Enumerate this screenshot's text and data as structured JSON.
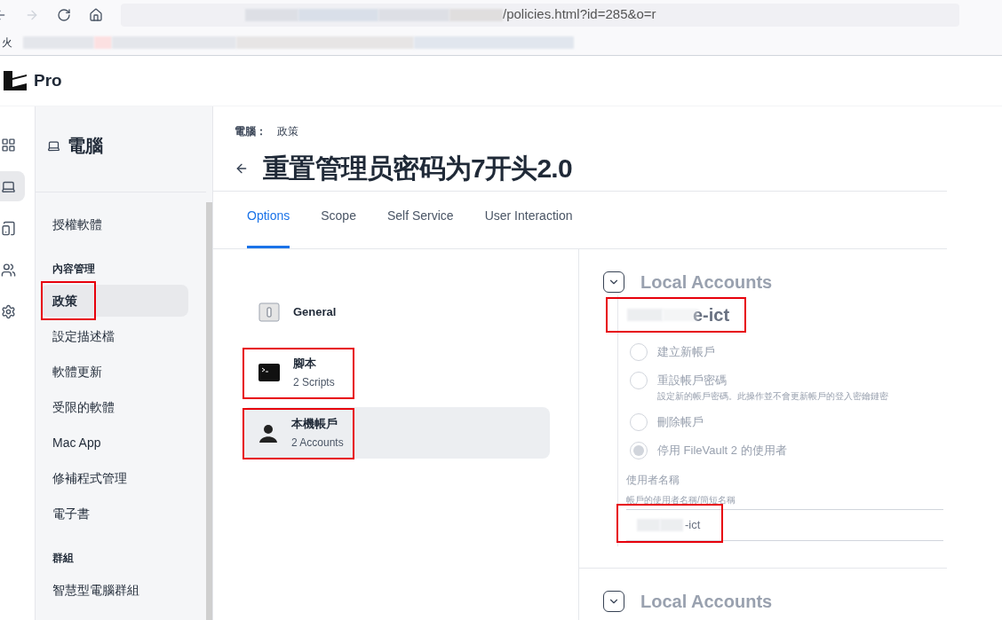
{
  "browser": {
    "url_fragment": "/policies.html?id=285&o=r",
    "bookmark_fragment": "火"
  },
  "app": {
    "product": "Pro"
  },
  "rail": [
    {
      "kind": "grid",
      "selected": false
    },
    {
      "kind": "laptop",
      "selected": true
    },
    {
      "kind": "devices",
      "selected": false
    },
    {
      "kind": "users",
      "selected": false
    },
    {
      "kind": "settings",
      "selected": false
    }
  ],
  "sidebar": {
    "title": "電腦",
    "sections": [
      {
        "items": [
          {
            "label": "授權軟體",
            "selected": false,
            "annotated": false
          }
        ]
      },
      {
        "heading": "內容管理",
        "items": [
          {
            "label": "政策",
            "selected": true,
            "annotated": true
          },
          {
            "label": "設定描述檔",
            "selected": false,
            "annotated": false
          },
          {
            "label": "軟體更新",
            "selected": false,
            "annotated": false
          },
          {
            "label": "受限的軟體",
            "selected": false,
            "annotated": false
          },
          {
            "label": "Mac App",
            "selected": false,
            "annotated": false
          },
          {
            "label": "修補程式管理",
            "selected": false,
            "annotated": false
          },
          {
            "label": "電子書",
            "selected": false,
            "annotated": false
          }
        ]
      },
      {
        "heading": "群組",
        "items": [
          {
            "label": "智慧型電腦群組",
            "selected": false,
            "annotated": false
          }
        ]
      }
    ]
  },
  "breadcrumb": [
    "電腦：",
    "政策"
  ],
  "page_title": "重置管理员密码为7开头2.0",
  "tabs": [
    {
      "label": "Options",
      "selected": true
    },
    {
      "label": "Scope",
      "selected": false
    },
    {
      "label": "Self Service",
      "selected": false
    },
    {
      "label": "User Interaction",
      "selected": false
    }
  ],
  "payloads": [
    {
      "kind": "general",
      "title": "General",
      "selected": false,
      "annotated": false
    },
    {
      "kind": "terminal",
      "title": "腳本",
      "subtitle": "2 Scripts",
      "selected": false,
      "annotated": true
    },
    {
      "kind": "person",
      "title": "本機帳戶",
      "subtitle": "2 Accounts",
      "selected": true,
      "annotated": true
    }
  ],
  "accounts": [
    {
      "heading": "Local Accounts",
      "expanded": true,
      "account_name": "e-ict",
      "annotated": true,
      "options": [
        {
          "label": "建立新帳戶",
          "selected": false
        },
        {
          "label": "重設帳戶密碼",
          "hint": "設定新的帳戶密碼。此操作並不會更新帳戶的登入密鑰鏈密",
          "selected": false
        },
        {
          "label": "刪除帳戶",
          "selected": false
        },
        {
          "label": "停用 FileVault 2 的使用者",
          "selected": true
        }
      ],
      "field_label": "使用者名稱",
      "field_hint": "帳戶的使用者名稱/簡短名稱",
      "field_value": "-ict",
      "field_annotated": true
    },
    {
      "heading": "Local Accounts",
      "expanded": true
    }
  ]
}
